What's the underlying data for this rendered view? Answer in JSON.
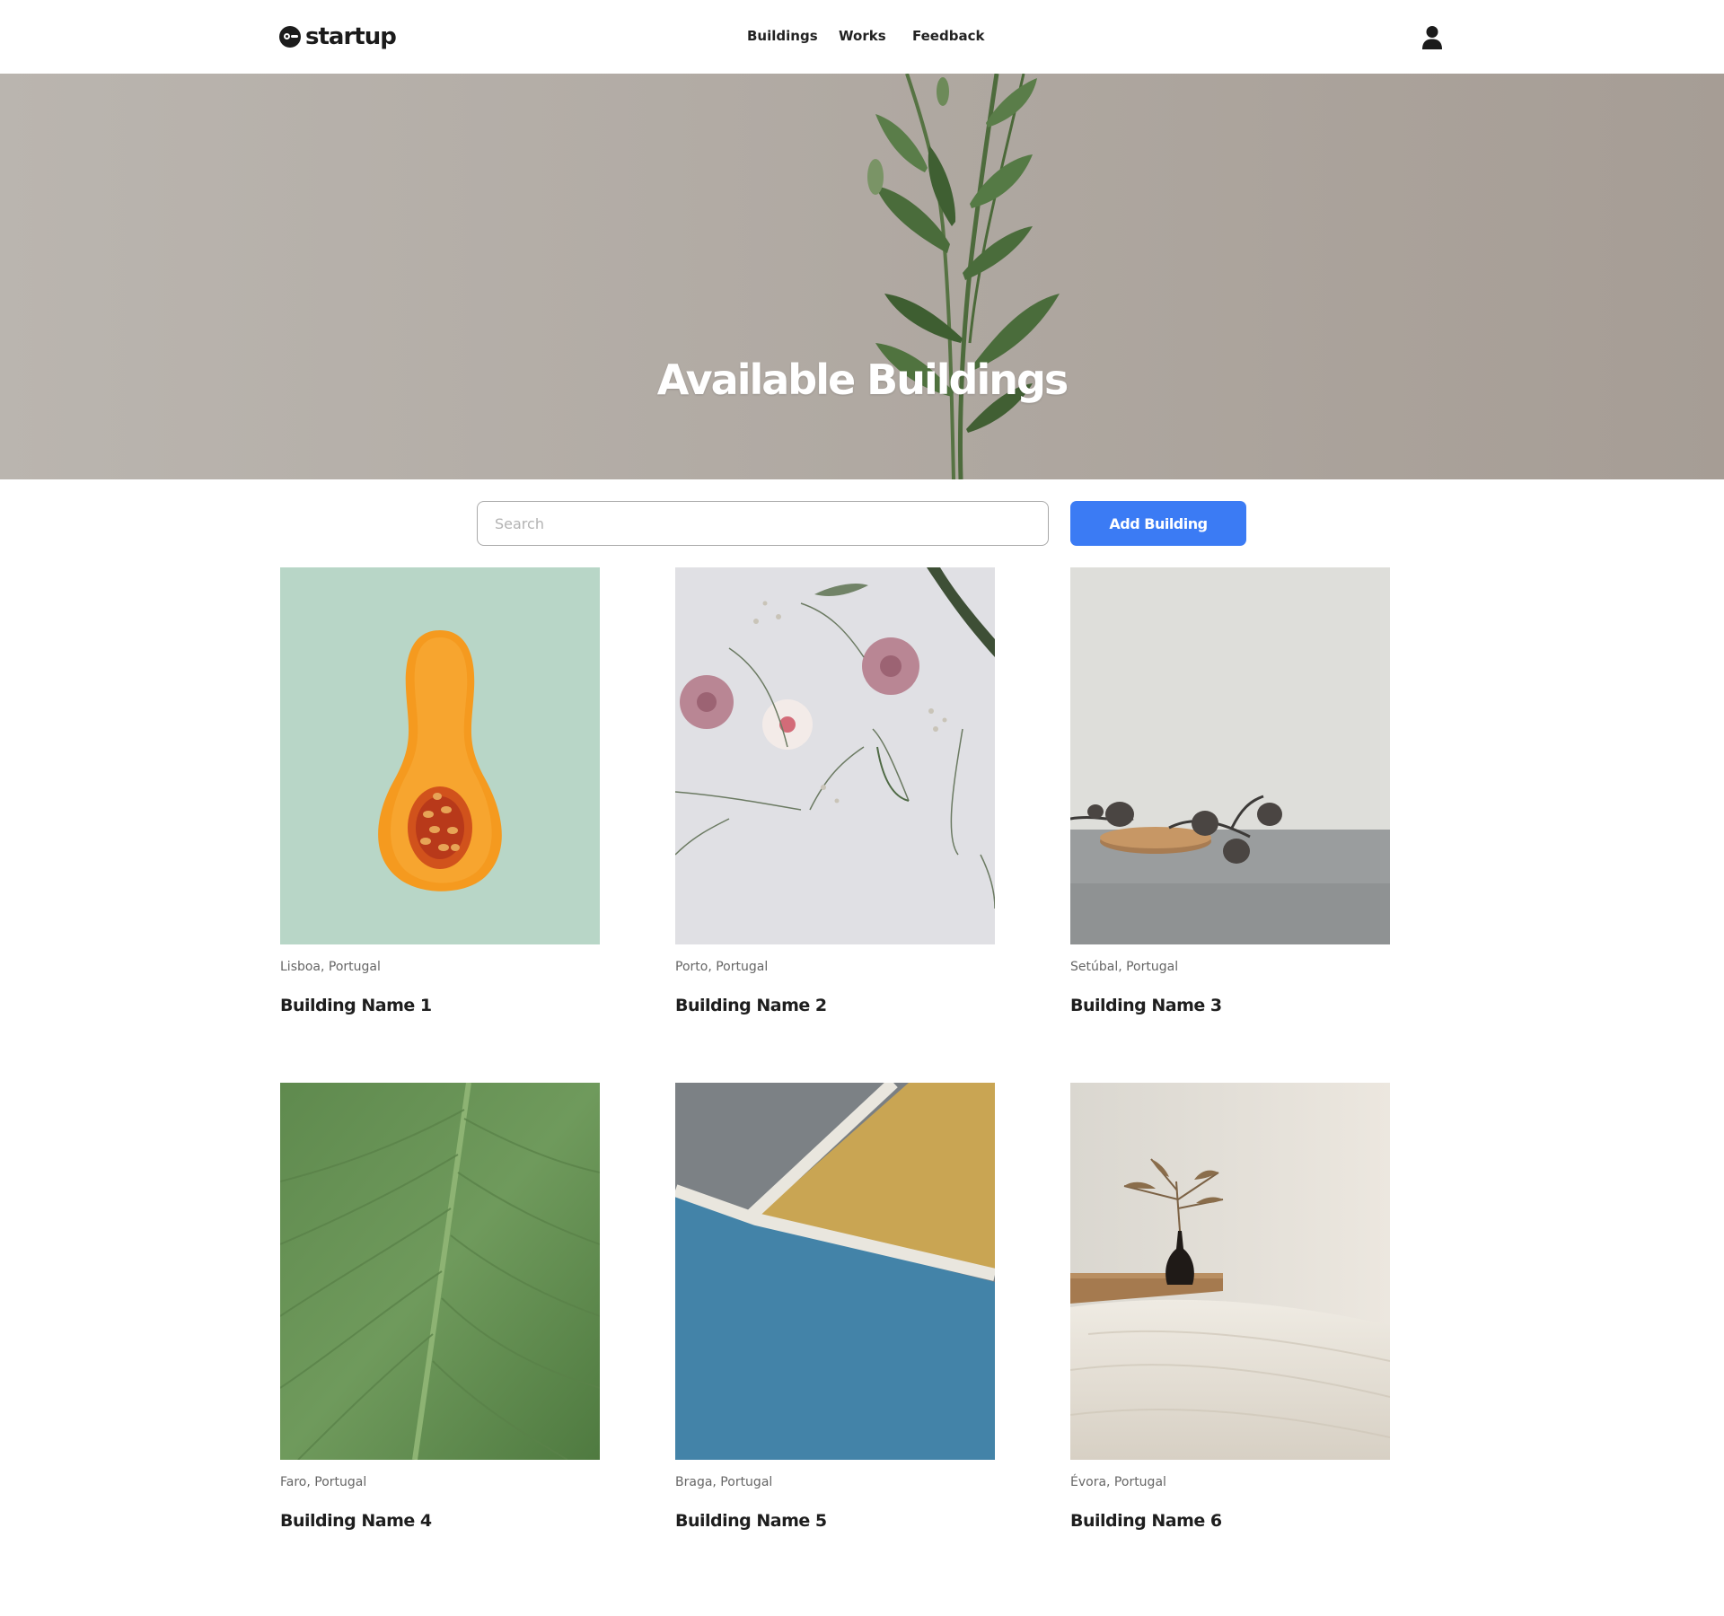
{
  "header": {
    "logo_text": "startup",
    "nav": [
      {
        "label": "Buildings"
      },
      {
        "label": "Works"
      },
      {
        "label": "Feedback"
      }
    ],
    "user_icon": "user-icon"
  },
  "hero": {
    "title": "Available Buildings"
  },
  "toolbar": {
    "search_placeholder": "Search",
    "search_value": "",
    "add_button_label": "Add Building",
    "accent_color": "#3b7bf4"
  },
  "buildings": [
    {
      "location": "Lisboa, Portugal",
      "name": "Building Name 1"
    },
    {
      "location": "Porto, Portugal",
      "name": "Building Name 2"
    },
    {
      "location": "Setúbal, Portugal",
      "name": "Building Name 3"
    },
    {
      "location": "Faro, Portugal",
      "name": "Building Name 4"
    },
    {
      "location": "Braga, Portugal",
      "name": "Building Name 5"
    },
    {
      "location": "Évora, Portugal",
      "name": "Building Name 6"
    }
  ]
}
